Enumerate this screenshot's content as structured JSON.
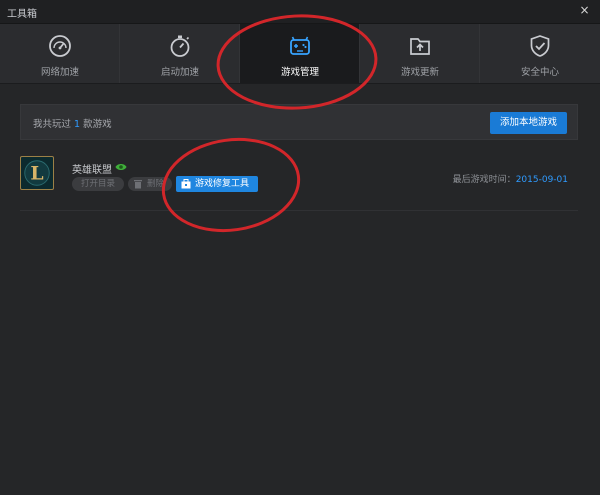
{
  "window": {
    "title": "工具箱",
    "close_symbol": "×"
  },
  "tabs": [
    {
      "label": "网络加速",
      "icon": "speedometer-icon",
      "active": false
    },
    {
      "label": "启动加速",
      "icon": "stopwatch-icon",
      "active": false
    },
    {
      "label": "游戏管理",
      "icon": "gamepad-icon",
      "active": true
    },
    {
      "label": "游戏更新",
      "icon": "upload-folder-icon",
      "active": false
    },
    {
      "label": "安全中心",
      "icon": "shield-check-icon",
      "active": false
    }
  ],
  "info_bar": {
    "prefix": "我共玩过",
    "count": "1",
    "suffix": "款游戏",
    "add_button": "添加本地游戏"
  },
  "games": [
    {
      "name": "英雄联盟",
      "logo_letter": "L",
      "buttons": {
        "open_dir": "打开目录",
        "delete": "删除",
        "repair": "游戏修复工具"
      },
      "last_played_label": "最后游戏时间：",
      "last_played_date": "2015-09-01"
    }
  ],
  "colors": {
    "accent": "#1f86e0",
    "annotation": "#d2262a",
    "highlight_text": "#2f9bff"
  }
}
